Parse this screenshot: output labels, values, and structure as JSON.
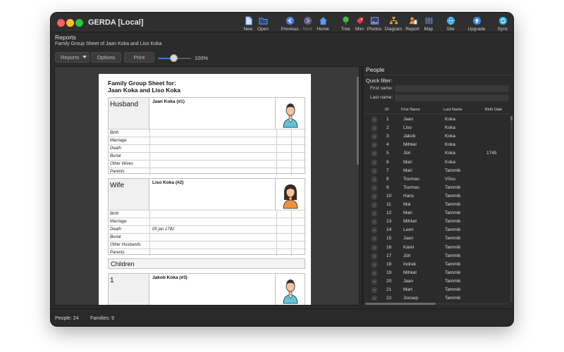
{
  "window": {
    "title": "GERDA [Local]"
  },
  "toolbar": {
    "items": [
      {
        "label": "New",
        "icon": "new-document-icon",
        "enabled": true
      },
      {
        "label": "Open",
        "icon": "folder-icon",
        "enabled": true
      },
      {
        "label": "Previous",
        "icon": "previous-arrow-icon",
        "enabled": true
      },
      {
        "label": "Next",
        "icon": "next-arrow-icon",
        "enabled": false
      },
      {
        "label": "Home",
        "icon": "home-icon",
        "enabled": true
      },
      {
        "label": "Tree",
        "icon": "tree-icon",
        "enabled": true
      },
      {
        "label": "Mini",
        "icon": "tag-icon",
        "enabled": true
      },
      {
        "label": "Photos",
        "icon": "photos-icon",
        "enabled": true
      },
      {
        "label": "Diagram",
        "icon": "diagram-icon",
        "enabled": true
      },
      {
        "label": "Report",
        "icon": "report-icon",
        "enabled": true
      },
      {
        "label": "Map",
        "icon": "map-icon",
        "enabled": true
      },
      {
        "label": "Site",
        "icon": "globe-icon",
        "enabled": true
      },
      {
        "label": "Upgrade",
        "icon": "upgrade-icon",
        "enabled": true
      },
      {
        "label": "Sync",
        "icon": "sync-icon",
        "enabled": true
      }
    ]
  },
  "header": {
    "title": "Reports",
    "subtitle": "Family Group Sheet of Jaan Koka and Liso Koka"
  },
  "reportbar": {
    "reports_label": "Reports",
    "options_label": "Options",
    "print_label": "Print",
    "zoom": "100%",
    "zoom_fraction": 0.5
  },
  "sheet": {
    "title_line1": "Family Group Sheet for:",
    "title_line2": "Jaan Koka and Liso Koka",
    "husband": {
      "role": "Husband",
      "name": "Jaan Koka (#1)",
      "events": [
        {
          "label": "Birth",
          "value": ""
        },
        {
          "label": "Marriage",
          "value": ""
        },
        {
          "label": "Death",
          "value": ""
        },
        {
          "label": "Burial",
          "value": ""
        },
        {
          "label": "Other Wives",
          "value": ""
        },
        {
          "label": "Parents",
          "value": ""
        }
      ]
    },
    "wife": {
      "role": "Wife",
      "name": "Liso Koka (#2)",
      "events": [
        {
          "label": "Birth",
          "value": ""
        },
        {
          "label": "Marriage",
          "value": ""
        },
        {
          "label": "Death",
          "value": "05 jan 1782"
        },
        {
          "label": "Burial",
          "value": ""
        },
        {
          "label": "Other Husbands",
          "value": ""
        },
        {
          "label": "Parents",
          "value": ""
        }
      ]
    },
    "children_label": "Children",
    "child1": {
      "number": "1",
      "name": "Jakob Koka (#3)"
    }
  },
  "people": {
    "title": "People",
    "quick_filter_label": "Quick filter:",
    "first_name_label": "First name:",
    "last_name_label": "Last name:",
    "first_name_value": "",
    "last_name_value": "",
    "columns": [
      "ID",
      "First Name",
      "Last Name",
      "Birth Date"
    ],
    "rows": [
      {
        "id": "1",
        "first": "Jaan",
        "last": "Koka",
        "birth": ""
      },
      {
        "id": "2",
        "first": "Liso",
        "last": "Koka",
        "birth": ""
      },
      {
        "id": "3",
        "first": "Jakob",
        "last": "Koka",
        "birth": ""
      },
      {
        "id": "4",
        "first": "Mihkel",
        "last": "Koka",
        "birth": ""
      },
      {
        "id": "5",
        "first": "Jüri",
        "last": "Koka",
        "birth": "1745"
      },
      {
        "id": "6",
        "first": "Mari",
        "last": "Koka",
        "birth": ""
      },
      {
        "id": "7",
        "first": "Mari",
        "last": "Tammik",
        "birth": ""
      },
      {
        "id": "8",
        "first": "Toomas",
        "last": "Võsu",
        "birth": ""
      },
      {
        "id": "9",
        "first": "Toomas",
        "last": "Tammik",
        "birth": ""
      },
      {
        "id": "10",
        "first": "Hans",
        "last": "Tammik",
        "birth": ""
      },
      {
        "id": "11",
        "first": "Mai",
        "last": "Tammik",
        "birth": ""
      },
      {
        "id": "12",
        "first": "Mari",
        "last": "Tammik",
        "birth": ""
      },
      {
        "id": "13",
        "first": "Mihkel",
        "last": "Tammik",
        "birth": ""
      },
      {
        "id": "14",
        "first": "Leen",
        "last": "Tammik",
        "birth": ""
      },
      {
        "id": "15",
        "first": "Jaan",
        "last": "Tammik",
        "birth": ""
      },
      {
        "id": "16",
        "first": "Karel",
        "last": "Tammik",
        "birth": ""
      },
      {
        "id": "17",
        "first": "Jüri",
        "last": "Tammik",
        "birth": ""
      },
      {
        "id": "18",
        "first": "Indrek",
        "last": "Tammik",
        "birth": ""
      },
      {
        "id": "19",
        "first": "Mihkel",
        "last": "Tammik",
        "birth": ""
      },
      {
        "id": "20",
        "first": "Jaan",
        "last": "Tammik",
        "birth": ""
      },
      {
        "id": "21",
        "first": "Mart",
        "last": "Tammik",
        "birth": ""
      },
      {
        "id": "22",
        "first": "Joosep",
        "last": "Tammik",
        "birth": ""
      }
    ]
  },
  "status": {
    "people": "People: 24",
    "families": "Families: 9"
  },
  "colors": {
    "accent": "#2f7bf5",
    "traffic_red": "#ff5f57",
    "traffic_yellow": "#febc2e",
    "traffic_green": "#28c840"
  }
}
